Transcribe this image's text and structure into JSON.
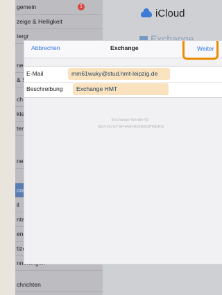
{
  "sidebar": {
    "items": [
      {
        "label": "gemein"
      },
      {
        "label": "zeige & Helligkeit"
      },
      {
        "label": "tergr"
      },
      {
        "label": "ne"
      },
      {
        "label": "& S"
      },
      {
        "label": "ch I"
      },
      {
        "label": "kterie"
      },
      {
        "label": "tens"
      },
      {
        "label": "nes"
      },
      {
        "label": "cour"
      },
      {
        "label": "il"
      },
      {
        "label": "ntakt"
      },
      {
        "label": "end"
      },
      {
        "label": "tize"
      },
      {
        "label": "nnerungen"
      },
      {
        "label": "chrichten"
      }
    ],
    "badge": "1"
  },
  "right": {
    "brand": "iCloud",
    "exchange_text": "Exchange"
  },
  "modal": {
    "cancel": "Abbrechen",
    "title": "Exchange",
    "next": "Weiter",
    "email_label": "E-Mail",
    "email_value": "mm61wuky@stud.hmt-leipzig.de",
    "description_label": "Beschreibung",
    "description_value": "Exchange HMT",
    "device_id_label": "Exchange-Geräte-ID",
    "device_id": "6B7IOVUTSP4A84ID9B8OPRERG"
  },
  "colors": {
    "accent": "#2f74de",
    "highlight": "#eb8b00",
    "field_fill": "#fae2be"
  }
}
